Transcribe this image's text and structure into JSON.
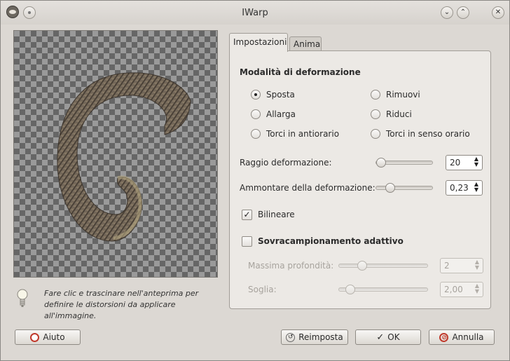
{
  "window": {
    "title": "IWarp"
  },
  "tabs": [
    {
      "label": "Impostazioni"
    },
    {
      "label": "Anima"
    }
  ],
  "deform_mode": {
    "title": "Modalità di deformazione",
    "options": [
      {
        "label": "Sposta",
        "selected": true
      },
      {
        "label": "Rimuovi",
        "selected": false
      },
      {
        "label": "Allarga",
        "selected": false
      },
      {
        "label": "Riduci",
        "selected": false
      },
      {
        "label": "Torci in antiorario",
        "selected": false
      },
      {
        "label": "Torci in senso orario",
        "selected": false
      }
    ]
  },
  "radius": {
    "label": "Raggio deformazione:",
    "value": "20"
  },
  "amount": {
    "label": "Ammontare della deformazione:",
    "value": "0,23"
  },
  "bilinear": {
    "label": "Bilineare",
    "checked": true
  },
  "supersample": {
    "label": "Sovracampionamento adattivo",
    "checked": false,
    "depth": {
      "label": "Massima profondità:",
      "value": "2"
    },
    "threshold": {
      "label": "Soglia:",
      "value": "2,00"
    }
  },
  "hint": "Fare clic e trascinare nell'anteprima per definire le distorsioni da applicare all'immagine.",
  "buttons": {
    "help": "Aiuto",
    "reset": "Reimposta",
    "ok": "OK",
    "cancel": "Annulla"
  },
  "icons": {
    "app": "gimp-icon",
    "hint": "lightbulb-icon",
    "help": "help-lifebuoy-icon",
    "reset": "reset-icon",
    "ok": "checkmark-icon",
    "cancel": "cancel-icon"
  }
}
